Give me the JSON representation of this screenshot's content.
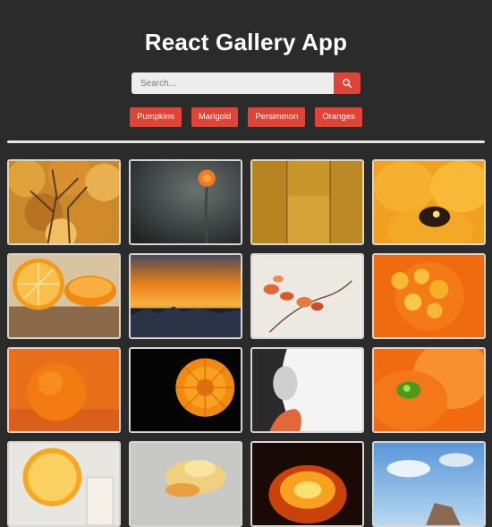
{
  "app": {
    "title": "React Gallery App"
  },
  "search": {
    "placeholder": "Search...",
    "icon": "search-icon"
  },
  "nav": {
    "items": [
      {
        "label": "Pumpkins"
      },
      {
        "label": "Marigold"
      },
      {
        "label": "Persimmon"
      },
      {
        "label": "Oranges"
      }
    ]
  },
  "colors": {
    "accent": "#e04436",
    "background": "#2b2b2b",
    "divider": "#e6e6e6"
  },
  "gallery": {
    "photos": [
      {
        "subject": "autumn-tree"
      },
      {
        "subject": "orange-flower-dark"
      },
      {
        "subject": "golden-wall"
      },
      {
        "subject": "orange-pansy"
      },
      {
        "subject": "sliced-orange"
      },
      {
        "subject": "orange-sunset"
      },
      {
        "subject": "dried-leaves-branch"
      },
      {
        "subject": "orange-flower-macro"
      },
      {
        "subject": "whole-orange"
      },
      {
        "subject": "marigold-black"
      },
      {
        "subject": "woman-portrait"
      },
      {
        "subject": "orange-flower-green-center"
      },
      {
        "subject": "orange-half-glass"
      },
      {
        "subject": "orange-petals-light"
      },
      {
        "subject": "pumpkin-lantern"
      },
      {
        "subject": "sky-blue"
      }
    ]
  }
}
